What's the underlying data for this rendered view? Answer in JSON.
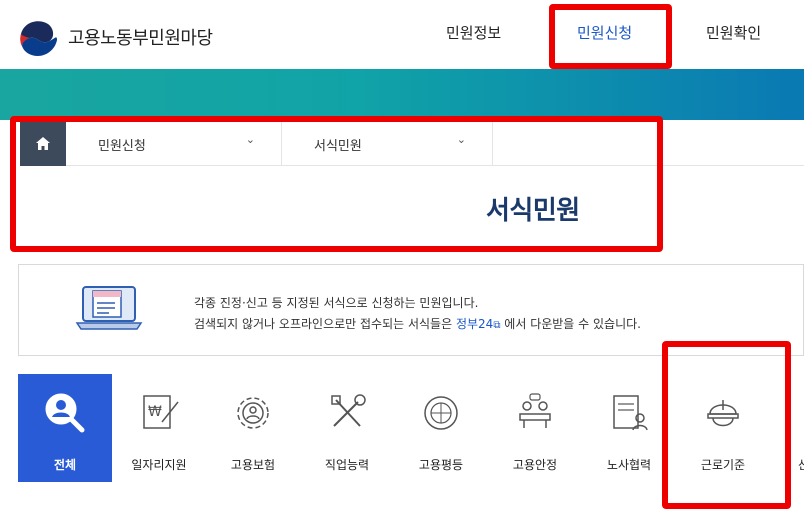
{
  "header": {
    "logo_text": "고용노동부민원마당",
    "nav": [
      "민원정보",
      "민원신청",
      "민원확인"
    ],
    "active_nav": "민원신청"
  },
  "breadcrumb": {
    "level1": "민원신청",
    "level2": "서식민원",
    "chevron": "⌄"
  },
  "page_title": "서식민원",
  "info": {
    "line1": "각종 진정·신고 등 지정된 서식으로 신청하는 민원입니다.",
    "line2_before": "검색되지 않거나 오프라인으로만 접수되는 서식들은",
    "line2_link": "정부24",
    "line2_after": "에서 다운받을 수 있습니다."
  },
  "categories": [
    {
      "label": "전체",
      "icon": "search-person-icon",
      "active": true
    },
    {
      "label": "일자리지원",
      "icon": "won-document-icon"
    },
    {
      "label": "고용보험",
      "icon": "gear-person-icon"
    },
    {
      "label": "직업능력",
      "icon": "tools-icon"
    },
    {
      "label": "고용평등",
      "icon": "globe-people-icon"
    },
    {
      "label": "고용안정",
      "icon": "meeting-icon"
    },
    {
      "label": "노사협력",
      "icon": "document-person-icon"
    },
    {
      "label": "근로기준",
      "icon": "helmet-icon"
    },
    {
      "label": "산"
    }
  ],
  "colors": {
    "active_tab": "#2a5bd7",
    "highlight": "#ee0000",
    "title": "#1b3a6b",
    "link": "#1a56c8"
  }
}
